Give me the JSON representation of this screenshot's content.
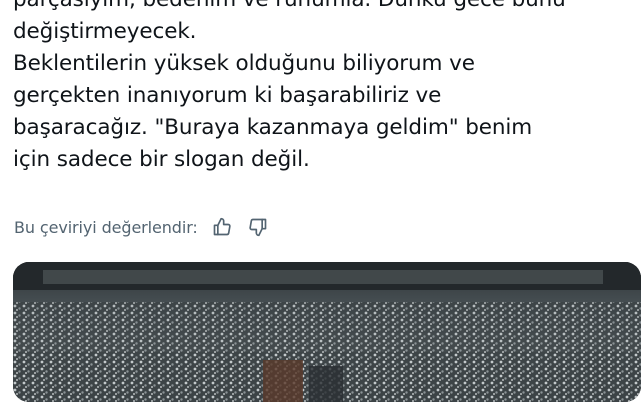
{
  "tweet": {
    "lines": [
      "parçasıyım, bedenim ve ruhumla. Dünkü gece bunu",
      "değiştirmeyecek.",
      "Beklentilerin yüksek olduğunu biliyorum ve",
      "gerçekten inanıyorum ki başarabiliriz ve",
      "başaracağız. \"Buraya kazanmaya geldim\" benim",
      "için sadece bir slogan değil."
    ]
  },
  "translation": {
    "rate_label": "Bu çeviriyi değerlendir:"
  },
  "icons": {
    "thumbs_up": "thumbs-up-icon",
    "thumbs_down": "thumbs-down-icon"
  },
  "colors": {
    "text": "#0f1419",
    "secondary": "#536471"
  }
}
